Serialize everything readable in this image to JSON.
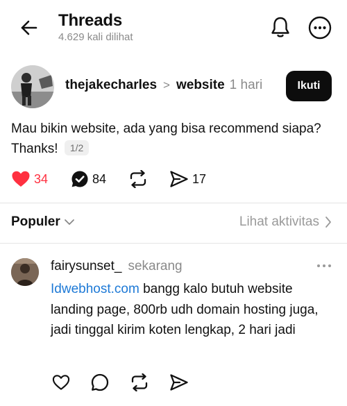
{
  "header": {
    "title": "Threads",
    "views": "4.629 kali dilihat",
    "icons": [
      "back-arrow-icon",
      "bell-icon",
      "more-circle-icon"
    ]
  },
  "post": {
    "username": "thejakecharles",
    "separator": ">",
    "topic": "website",
    "time": "1 hari",
    "follow_label": "Ikuti",
    "text": "Mau bikin website, ada yang bisa recommend siapa? Thanks!",
    "page_badge": "1/2",
    "stats": {
      "likes": "34",
      "comments": "84",
      "shares": "17"
    },
    "colors": {
      "liked": "#ff3040",
      "follow_bg": "#0d0d0d"
    }
  },
  "replies_header": {
    "sort_label": "Populer",
    "activity_label": "Lihat aktivitas"
  },
  "reply": {
    "username": "fairysunset_",
    "time": "sekarang",
    "link_text": "Idwebhost.com",
    "text": " bangg kalo butuh website landing page, 800rb udh domain hosting juga, jadi tinggal kirim koten lengkap, 2 hari jadi",
    "colors": {
      "link": "#1d79d6"
    }
  }
}
